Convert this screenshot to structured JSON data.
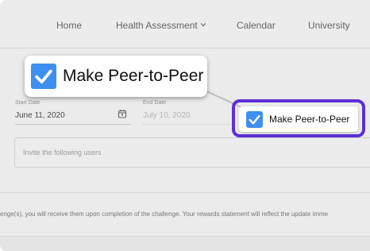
{
  "nav": {
    "items": [
      {
        "label": "Home"
      },
      {
        "label": "Health Assessment"
      },
      {
        "label": "Calendar"
      },
      {
        "label": "University"
      }
    ]
  },
  "form": {
    "start_date": {
      "label": "Start Date",
      "value": "June 11, 2020"
    },
    "end_date": {
      "label": "End Date",
      "value": "July 10, 2020"
    },
    "invite": {
      "placeholder": "Invite the following users"
    },
    "peer_to_peer": {
      "label": "Make Peer-to-Peer",
      "checked": true
    }
  },
  "notice": {
    "text": "enge(s), you will receive them upon completion of the challenge. Your rewards statement will reflect the update imme"
  },
  "callout": {
    "label": "Make Peer-to-Peer",
    "checked": true
  },
  "colors": {
    "accent": "#3d8ff0",
    "highlight": "#5b30d6",
    "background": "#ebebeb"
  }
}
